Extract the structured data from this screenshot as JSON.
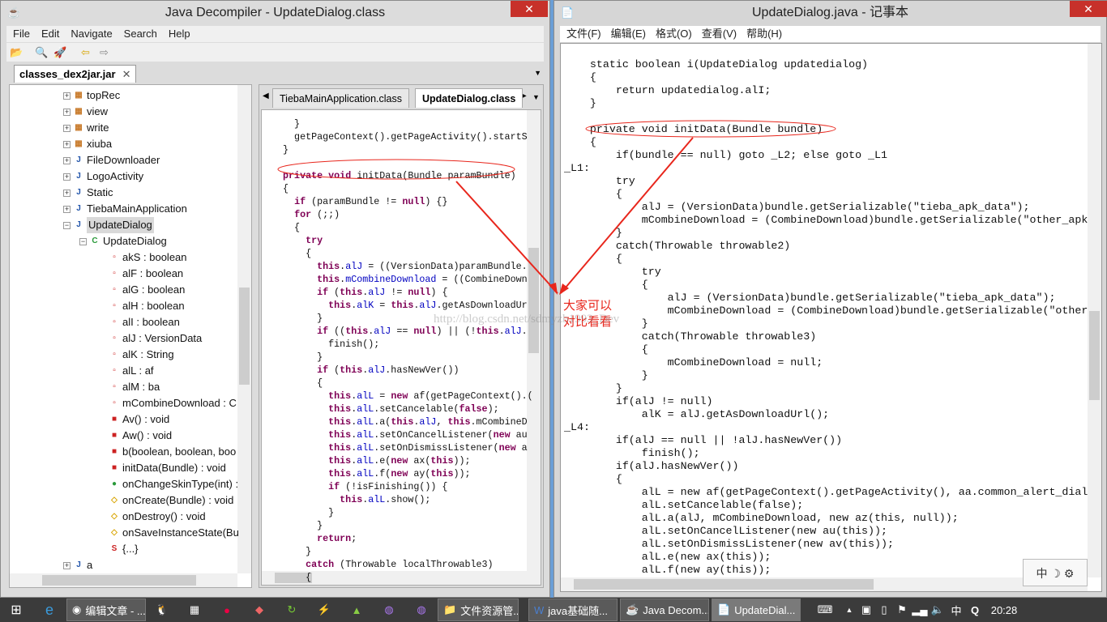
{
  "left_window": {
    "title": "Java Decompiler - UpdateDialog.class",
    "close_label": "✕",
    "menu": [
      "File",
      "Edit",
      "Navigate",
      "Search",
      "Help"
    ],
    "file_tab": "classes_dex2jar.jar",
    "tree": [
      {
        "label": "topRec",
        "level": 1,
        "icon": "package-icon",
        "exp": "+"
      },
      {
        "label": "view",
        "level": 1,
        "icon": "package-icon",
        "exp": "+"
      },
      {
        "label": "write",
        "level": 1,
        "icon": "package-icon",
        "exp": "+"
      },
      {
        "label": "xiuba",
        "level": 1,
        "icon": "package-icon",
        "exp": "+"
      },
      {
        "label": "FileDownloader",
        "level": 1,
        "icon": "java-file-icon",
        "exp": "+"
      },
      {
        "label": "LogoActivity",
        "level": 1,
        "icon": "java-file-icon",
        "exp": "+"
      },
      {
        "label": "Static",
        "level": 1,
        "icon": "java-file-icon",
        "exp": "+"
      },
      {
        "label": "TiebaMainApplication",
        "level": 1,
        "icon": "java-file-icon",
        "exp": "+"
      },
      {
        "label": "UpdateDialog",
        "level": 1,
        "icon": "java-file-icon",
        "exp": "-",
        "selected": true
      },
      {
        "label": "UpdateDialog",
        "level": 2,
        "icon": "class-icon",
        "exp": "-"
      },
      {
        "label": "akS : boolean",
        "level": 3,
        "icon": "private-field-icon"
      },
      {
        "label": "alF : boolean",
        "level": 3,
        "icon": "private-field-icon"
      },
      {
        "label": "alG : boolean",
        "level": 3,
        "icon": "private-field-icon"
      },
      {
        "label": "alH : boolean",
        "level": 3,
        "icon": "private-field-icon"
      },
      {
        "label": "alI : boolean",
        "level": 3,
        "icon": "private-field-icon"
      },
      {
        "label": "alJ : VersionData",
        "level": 3,
        "icon": "private-field-icon"
      },
      {
        "label": "alK : String",
        "level": 3,
        "icon": "private-field-icon"
      },
      {
        "label": "alL : af",
        "level": 3,
        "icon": "private-field-icon"
      },
      {
        "label": "alM : ba",
        "level": 3,
        "icon": "private-field-icon"
      },
      {
        "label": "mCombineDownload : C",
        "level": 3,
        "icon": "private-field-icon"
      },
      {
        "label": "Av() : void",
        "level": 3,
        "icon": "private-method-icon"
      },
      {
        "label": "Aw() : void",
        "level": 3,
        "icon": "private-method-icon"
      },
      {
        "label": "b(boolean, boolean, boo",
        "level": 3,
        "icon": "private-method-icon"
      },
      {
        "label": "initData(Bundle) : void",
        "level": 3,
        "icon": "private-method-icon"
      },
      {
        "label": "onChangeSkinType(int) :",
        "level": 3,
        "icon": "public-method-icon"
      },
      {
        "label": "onCreate(Bundle) : void",
        "level": 3,
        "icon": "protected-method-icon"
      },
      {
        "label": "onDestroy() : void",
        "level": 3,
        "icon": "protected-method-icon"
      },
      {
        "label": "onSaveInstanceState(Bu",
        "level": 3,
        "icon": "protected-method-icon"
      },
      {
        "label": "{...}",
        "level": 3,
        "icon": "static-init-icon"
      },
      {
        "label": "a",
        "level": 1,
        "icon": "java-file-icon",
        "exp": "+"
      }
    ],
    "code_tabs": [
      {
        "label": "TiebaMainApplication.class",
        "active": false
      },
      {
        "label": "UpdateDialog.class",
        "active": true
      }
    ],
    "code_lines": [
      "    }",
      "    getPageContext().getPageActivity().startS",
      "  }",
      "",
      "  private void initData(Bundle paramBundle)",
      "  {",
      "    if (paramBundle != null) {}",
      "    for (;;)",
      "    {",
      "      try",
      "      {",
      "        this.alJ = ((VersionData)paramBundle.",
      "        this.mCombineDownload = ((CombineDown",
      "        if (this.alJ != null) {",
      "          this.alK = this.alJ.getAsDownloadUr",
      "        }",
      "        if ((this.alJ == null) || (!this.alJ.",
      "          finish();",
      "        }",
      "        if (this.alJ.hasNewVer())",
      "        {",
      "          this.alL = new af(getPageContext().(",
      "          this.alL.setCancelable(false);",
      "          this.alL.a(this.alJ, this.mCombineD",
      "          this.alL.setOnCancelListener(new au",
      "          this.alL.setOnDismissListener(new a",
      "          this.alL.e(new ax(this));",
      "          this.alL.f(new ay(this));",
      "          if (!isFinishing()) {",
      "            this.alL.show();",
      "          }",
      "        }",
      "        return;",
      "      }",
      "      catch (Throwable localThrowable3)",
      "      {"
    ]
  },
  "right_window": {
    "title": "UpdateDialog.java - 记事本",
    "close_label": "✕",
    "menu": [
      "文件(F)",
      "编辑(E)",
      "格式(O)",
      "查看(V)",
      "帮助(H)"
    ],
    "lines": [
      "    static boolean i(UpdateDialog updatedialog)",
      "    {",
      "        return updatedialog.alI;",
      "    }",
      "",
      "    private void initData(Bundle bundle)",
      "    {",
      "        if(bundle == null) goto _L2; else goto _L1",
      "_L1:",
      "        try",
      "        {",
      "            alJ = (VersionData)bundle.getSerializable(\"tieba_apk_data\");",
      "            mCombineDownload = (CombineDownload)bundle.getSerializable(\"other_apk",
      "        }",
      "        catch(Throwable throwable2)",
      "        {",
      "            try",
      "            {",
      "                alJ = (VersionData)bundle.getSerializable(\"tieba_apk_data\");",
      "                mCombineDownload = (CombineDownload)bundle.getSerializable(\"other",
      "            }",
      "            catch(Throwable throwable3)",
      "            {",
      "                mCombineDownload = null;",
      "            }",
      "        }",
      "        if(alJ != null)",
      "            alK = alJ.getAsDownloadUrl();",
      "_L4:",
      "        if(alJ == null || !alJ.hasNewVer())",
      "            finish();",
      "        if(alJ.hasNewVer())",
      "        {",
      "            alL = new af(getPageContext().getPageActivity(), aa.common_alert_dial",
      "            alL.setCancelable(false);",
      "            alL.a(alJ, mCombineDownload, new az(this, null));",
      "            alL.setOnCancelListener(new au(this));",
      "            alL.setOnDismissListener(new av(this));",
      "            alL.e(new ax(this));",
      "            alL.f(new ay(this));"
    ]
  },
  "annotation": {
    "line1": "大家可以",
    "line2": "对比看看",
    "watermark": "http://blog.csdn.net/sdmyzb1993_Dev",
    "color": "#e8261c"
  },
  "taskbar": {
    "apps": [
      {
        "label": "编辑文章 - ...",
        "icon": "chrome-icon"
      },
      {
        "label": "文件资源管...",
        "icon": "explorer-icon"
      },
      {
        "label": "java基础随...",
        "icon": "word-icon"
      },
      {
        "label": "Java Decom...",
        "icon": "java-decompiler-icon"
      },
      {
        "label": "UpdateDial...",
        "icon": "notepad-icon",
        "active": true
      }
    ],
    "ime": "中",
    "clock": "20:28"
  }
}
